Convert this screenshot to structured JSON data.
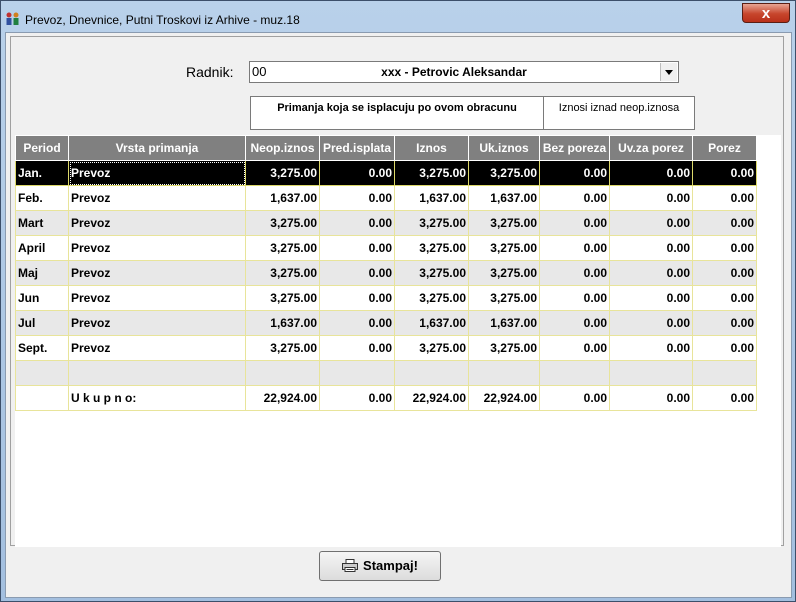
{
  "window": {
    "title": "Prevoz, Dnevnice, Putni Troskovi iz Arhive - muz.18",
    "close_label": "x"
  },
  "form": {
    "radnik_label": "Radnik:",
    "radnik_code": "00",
    "radnik_name": "xxx - Petrovic Aleksandar",
    "info_left": "Primanja koja se isplacuju po ovom obracunu",
    "info_right": "Iznosi iznad neop.iznosa"
  },
  "table": {
    "headers": [
      "Period",
      "Vrsta primanja",
      "Neop.iznos",
      "Pred.isplata",
      "Iznos",
      "Uk.iznos",
      "Bez poreza",
      "Uv.za porez",
      "Porez"
    ],
    "rows": [
      [
        "Jan.",
        "Prevoz",
        "3,275.00",
        "0.00",
        "3,275.00",
        "3,275.00",
        "0.00",
        "0.00",
        "0.00"
      ],
      [
        "Feb.",
        "Prevoz",
        "1,637.00",
        "0.00",
        "1,637.00",
        "1,637.00",
        "0.00",
        "0.00",
        "0.00"
      ],
      [
        "Mart",
        "Prevoz",
        "3,275.00",
        "0.00",
        "3,275.00",
        "3,275.00",
        "0.00",
        "0.00",
        "0.00"
      ],
      [
        "April",
        "Prevoz",
        "3,275.00",
        "0.00",
        "3,275.00",
        "3,275.00",
        "0.00",
        "0.00",
        "0.00"
      ],
      [
        "Maj",
        "Prevoz",
        "3,275.00",
        "0.00",
        "3,275.00",
        "3,275.00",
        "0.00",
        "0.00",
        "0.00"
      ],
      [
        "Jun",
        "Prevoz",
        "3,275.00",
        "0.00",
        "3,275.00",
        "3,275.00",
        "0.00",
        "0.00",
        "0.00"
      ],
      [
        "Jul",
        "Prevoz",
        "1,637.00",
        "0.00",
        "1,637.00",
        "1,637.00",
        "0.00",
        "0.00",
        "0.00"
      ],
      [
        "Sept.",
        "Prevoz",
        "3,275.00",
        "0.00",
        "3,275.00",
        "3,275.00",
        "0.00",
        "0.00",
        "0.00"
      ],
      [
        "",
        "",
        "",
        "",
        "",
        "",
        "",
        "",
        ""
      ],
      [
        "",
        "U k u p n o:",
        "22,924.00",
        "0.00",
        "22,924.00",
        "22,924.00",
        "0.00",
        "0.00",
        "0.00"
      ]
    ]
  },
  "footer": {
    "print_label": "Stampaj!"
  },
  "icons": {
    "app": "people-app-icon",
    "print": "printer-icon",
    "combo": "chevron-down-icon"
  },
  "colors": {
    "header_bg": "#808080",
    "selected_row_bg": "#000000",
    "grid_line": "#e8e49a",
    "close_button": "#c7452c"
  }
}
